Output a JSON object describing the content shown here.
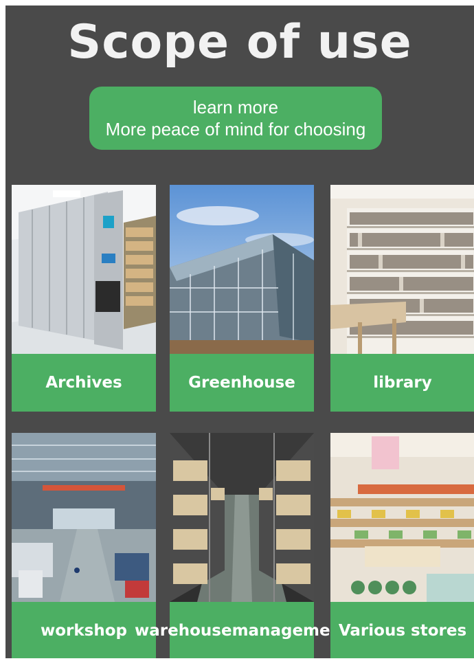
{
  "page": {
    "title": "Scope of use",
    "cta": {
      "line1": "learn more",
      "line2": "More peace of mind for choosing"
    }
  },
  "colors": {
    "background": "#4a4a4a",
    "accent": "#4caf63",
    "text": "#ffffff"
  },
  "cards": [
    {
      "label": "Archives",
      "image": "mobile-archive-shelving-photo"
    },
    {
      "label": "Greenhouse",
      "image": "glass-greenhouse-photo"
    },
    {
      "label": "library",
      "image": "library-bookshelves-photo"
    },
    {
      "label": "workshop",
      "image": "factory-workshop-photo"
    },
    {
      "label_line1": "warehouse",
      "label_line2": "management",
      "image": "warehouse-racking-aisle-photo"
    },
    {
      "label": "Various stores",
      "image": "retail-store-shelves-photo"
    }
  ]
}
